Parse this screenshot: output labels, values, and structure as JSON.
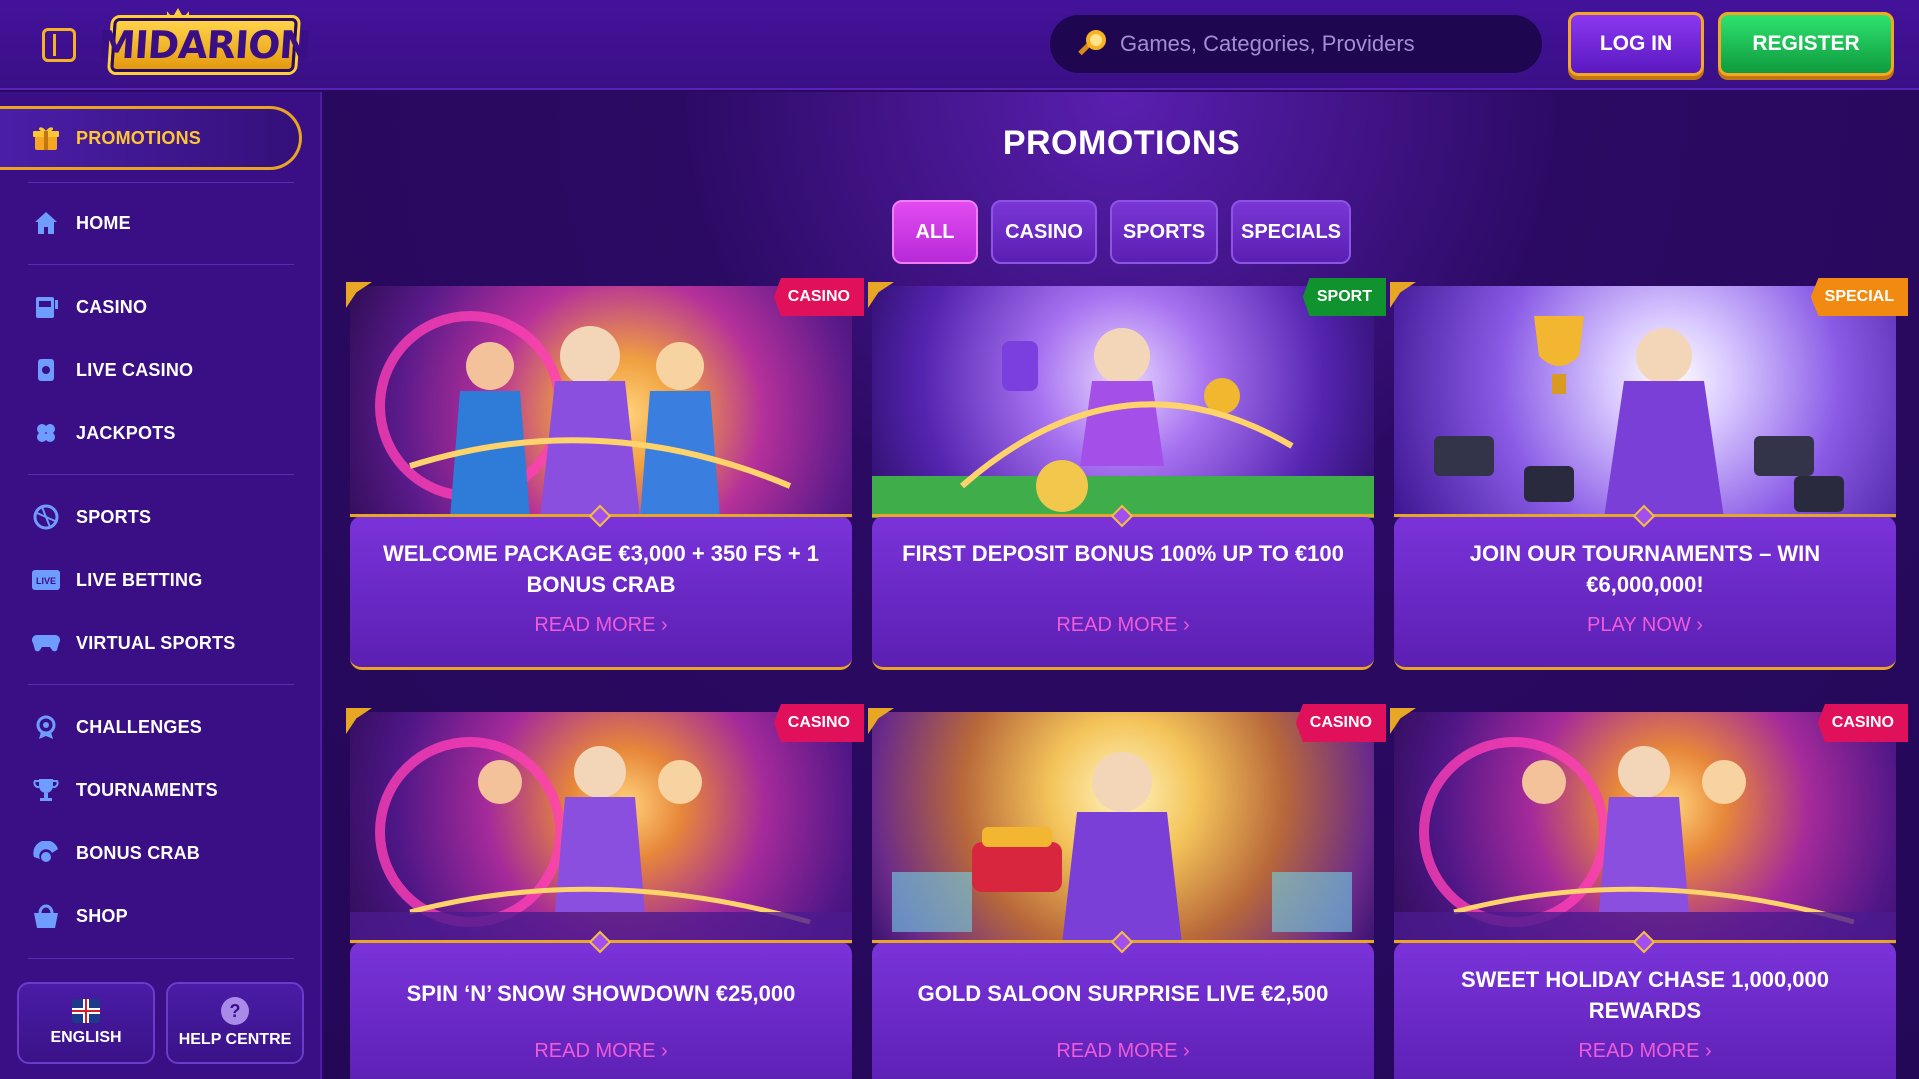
{
  "header": {
    "logo_text": "MIDARION",
    "search_placeholder": "Games, Categories, Providers",
    "login_label": "LOG IN",
    "register_label": "REGISTER"
  },
  "sidebar": {
    "active_item": "PROMOTIONS",
    "items": [
      {
        "label": "HOME",
        "icon": "home-icon"
      },
      {
        "label": "CASINO",
        "icon": "slot-machine-icon"
      },
      {
        "label": "LIVE CASINO",
        "icon": "live-casino-icon"
      },
      {
        "label": "JACKPOTS",
        "icon": "clover-icon"
      },
      {
        "label": "SPORTS",
        "icon": "ball-icon"
      },
      {
        "label": "LIVE BETTING",
        "icon": "live-badge-icon"
      },
      {
        "label": "VIRTUAL SPORTS",
        "icon": "gamepad-icon"
      },
      {
        "label": "CHALLENGES",
        "icon": "target-icon"
      },
      {
        "label": "TOURNAMENTS",
        "icon": "trophy-icon"
      },
      {
        "label": "BONUS CRAB",
        "icon": "crab-icon"
      },
      {
        "label": "SHOP",
        "icon": "basket-icon"
      }
    ],
    "language_label": "ENGLISH",
    "help_label": "HELP CENTRE"
  },
  "main": {
    "title": "PROMOTIONS",
    "filters": [
      "ALL",
      "CASINO",
      "SPORTS",
      "SPECIALS"
    ],
    "active_filter": "ALL",
    "cards": [
      {
        "tag": "CASINO",
        "title": "WELCOME PACKAGE €3,000 + 350 FS + 1 BONUS CRAB",
        "link": "READ MORE"
      },
      {
        "tag": "SPORT",
        "title": "FIRST DEPOSIT BONUS 100% UP TO €100",
        "link": "READ MORE"
      },
      {
        "tag": "SPECIAL",
        "title": "JOIN OUR TOURNAMENTS – WIN €6,000,000!",
        "link": "PLAY NOW"
      },
      {
        "tag": "CASINO",
        "title": "SPIN ‘N’ SNOW SHOWDOWN €25,000",
        "link": "READ MORE"
      },
      {
        "tag": "CASINO",
        "title": "GOLD SALOON SURPRISE LIVE €2,500",
        "link": "READ MORE"
      },
      {
        "tag": "CASINO",
        "title": "SWEET HOLIDAY CHASE 1,000,000 REWARDS",
        "link": "READ MORE"
      }
    ]
  },
  "colors": {
    "accent_gold": "#e7a624",
    "active_pink": "#d93ee8",
    "link_pink": "#f05bd6",
    "register_green": "#1fbf55"
  }
}
